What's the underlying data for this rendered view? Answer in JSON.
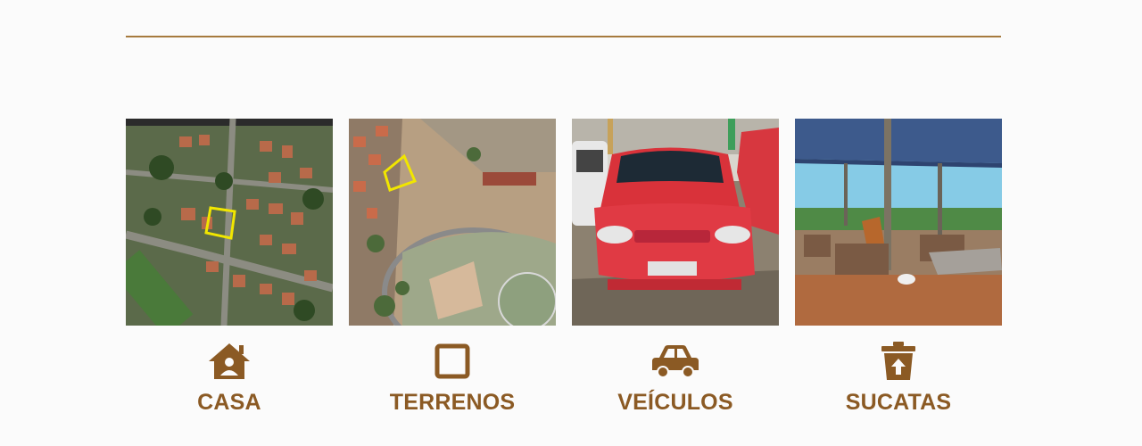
{
  "colors": {
    "accent": "#8b5a24",
    "divider": "#a67a3e",
    "background": "#fbfbfb"
  },
  "categories": [
    {
      "label": "CASA",
      "icon": "house-icon",
      "image": "aerial-houses-photo"
    },
    {
      "label": "TERRENOS",
      "icon": "square-outline-icon",
      "image": "aerial-land-photo"
    },
    {
      "label": "VEÍCULOS",
      "icon": "car-icon",
      "image": "red-car-photo"
    },
    {
      "label": "SUCATAS",
      "icon": "trash-icon",
      "image": "scrap-yard-photo"
    }
  ]
}
